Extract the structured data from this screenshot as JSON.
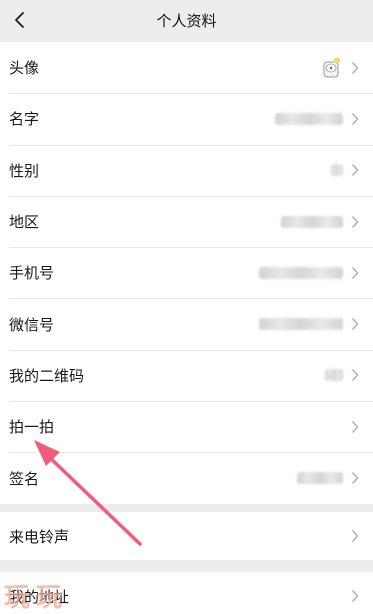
{
  "header": {
    "title": "个人资料"
  },
  "profile_rows": [
    {
      "label": "头像",
      "value_kind": "avatar"
    },
    {
      "label": "名字",
      "value_kind": "blurred"
    },
    {
      "label": "性别",
      "value_kind": "blurred"
    },
    {
      "label": "地区",
      "value_kind": "blurred"
    },
    {
      "label": "手机号",
      "value_kind": "blurred"
    },
    {
      "label": "微信号",
      "value_kind": "blurred"
    },
    {
      "label": "我的二维码",
      "value_kind": "blurred"
    },
    {
      "label": "拍一拍",
      "value_kind": "none"
    },
    {
      "label": "签名",
      "value_kind": "blurred"
    }
  ],
  "ringtone_row": {
    "label": "来电铃声"
  },
  "address_row": {
    "label": "我的地址"
  },
  "watermark": {
    "left": "玩",
    "middle": "",
    "right": "玩"
  },
  "colors": {
    "background": "#ededed",
    "card": "#ffffff",
    "arrow": "#f25c7a",
    "chevron": "#b2b2b2"
  },
  "icons": {
    "back": "chevron-left-icon",
    "row_arrow": "chevron-right-icon",
    "avatar": "avatar-image",
    "annotation": "pointer-arrow"
  }
}
